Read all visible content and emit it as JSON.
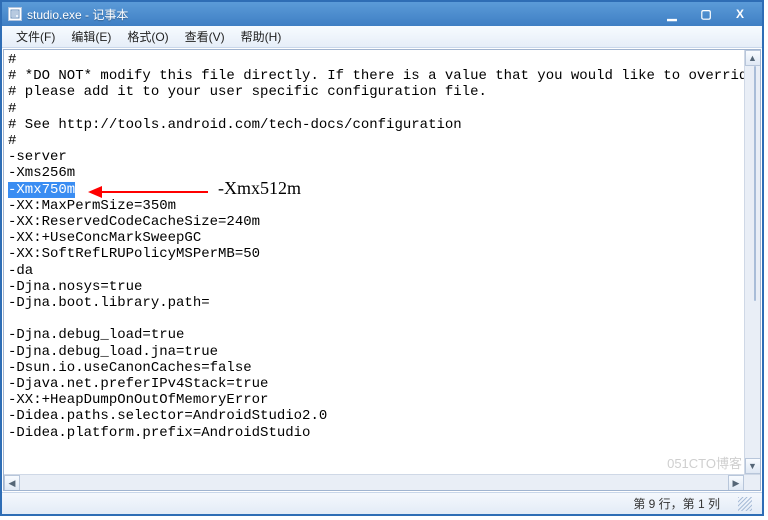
{
  "window": {
    "title": "studio.exe - 记事本",
    "buttons": {
      "min": "▁",
      "max": "▢",
      "close": "X"
    }
  },
  "menu": {
    "file": "文件(F)",
    "edit": "编辑(E)",
    "format": "格式(O)",
    "view": "查看(V)",
    "help": "帮助(H)"
  },
  "editor": {
    "line01": "#",
    "line02": "# *DO NOT* modify this file directly. If there is a value that you would like to override,",
    "line03": "# please add it to your user specific configuration file.",
    "line04": "#",
    "line05": "# See http://tools.android.com/tech-docs/configuration",
    "line06": "#",
    "line07": "-server",
    "line08": "-Xms256m",
    "line09_highlight": "-Xmx750m",
    "line10": "-XX:MaxPermSize=350m",
    "line11": "-XX:ReservedCodeCacheSize=240m",
    "line12": "-XX:+UseConcMarkSweepGC",
    "line13": "-XX:SoftRefLRUPolicyMSPerMB=50",
    "line14": "-da",
    "line15": "-Djna.nosys=true",
    "line16": "-Djna.boot.library.path=",
    "line17": "",
    "line18": "-Djna.debug_load=true",
    "line19": "-Djna.debug_load.jna=true",
    "line20": "-Dsun.io.useCanonCaches=false",
    "line21": "-Djava.net.preferIPv4Stack=true",
    "line22": "-XX:+HeapDumpOnOutOfMemoryError",
    "line23": "-Didea.paths.selector=AndroidStudio2.0",
    "line24": "-Didea.platform.prefix=AndroidStudio",
    "line25": ""
  },
  "annotation": {
    "text": "-Xmx512m",
    "arrow_color": "#ff0000"
  },
  "status": {
    "position": "第 9 行，第 1 列"
  },
  "watermark": "051CTO博客"
}
